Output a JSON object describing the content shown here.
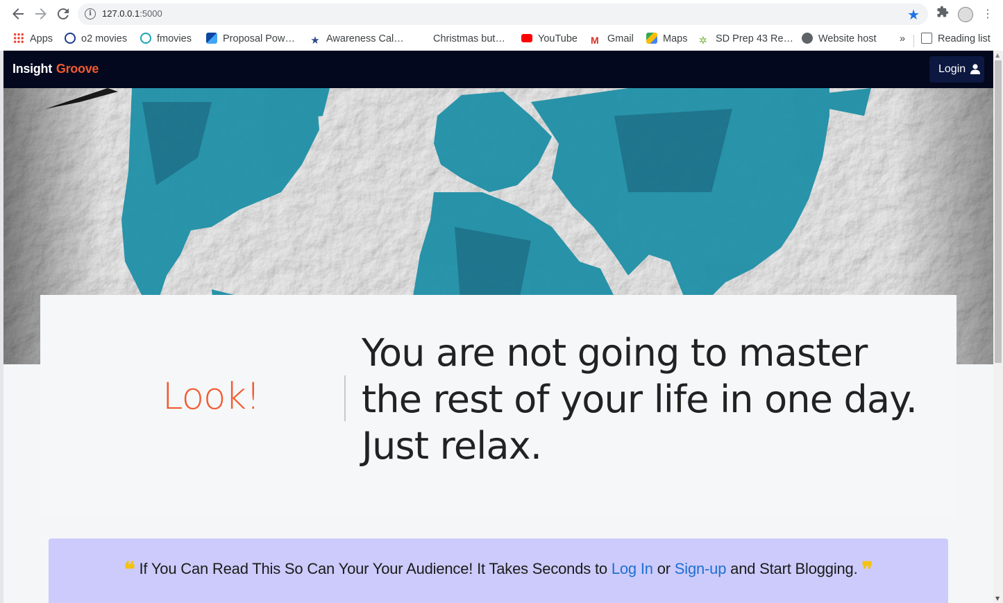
{
  "browser": {
    "url_host": "127.0.0.1",
    "url_port": ":5000",
    "bookmarks": [
      {
        "label": "Apps",
        "icon": "apps-grid-icon",
        "color": "#ea4335"
      },
      {
        "label": "o2 movies",
        "icon": "o2-icon",
        "color": "#1a3a8a"
      },
      {
        "label": "fmovies",
        "icon": "play-circle-icon",
        "color": "#1aa3b3"
      },
      {
        "label": "Proposal Pow…",
        "icon": "proposal-icon",
        "color": "#1565c0"
      },
      {
        "label": "Awareness Cal…",
        "icon": "star-icon",
        "color": "#2c4a8a"
      },
      {
        "label": "Christmas but…",
        "icon": "blank-icon",
        "color": "#ffffff"
      },
      {
        "label": "YouTube",
        "icon": "youtube-icon",
        "color": "#ff0000"
      },
      {
        "label": "Gmail",
        "icon": "gmail-icon",
        "color": "#d93025"
      },
      {
        "label": "Maps",
        "icon": "maps-icon",
        "color": "#34a853"
      },
      {
        "label": "SD Prep 43 Re…",
        "icon": "plant-icon",
        "color": "#7cb342"
      },
      {
        "label": "Website host",
        "icon": "globe-icon",
        "color": "#5f6368"
      }
    ],
    "overflow_label": "»",
    "reading_list_label": "Reading list"
  },
  "navbar": {
    "brand_part1": "Insight",
    "brand_part2": "Groove",
    "login_label": "Login"
  },
  "quote": {
    "lead": "Look!",
    "text": "You are not going to master the rest of your life in one day. Just relax."
  },
  "cta": {
    "before": "If You Can Read This So Can Your Your Audience! It Takes Seconds to",
    "login_link": "Log In",
    "or": "or",
    "signup_link": "Sign-up",
    "after": "and Start Blogging.",
    "open_quote": "❝",
    "close_quote": "❞"
  },
  "colors": {
    "accent": "#f25a2e",
    "navbar_bg": "#03081e",
    "cta_bg": "#cccbfb",
    "link": "#1f6fd1",
    "map_teal": "#1f8fa6"
  }
}
